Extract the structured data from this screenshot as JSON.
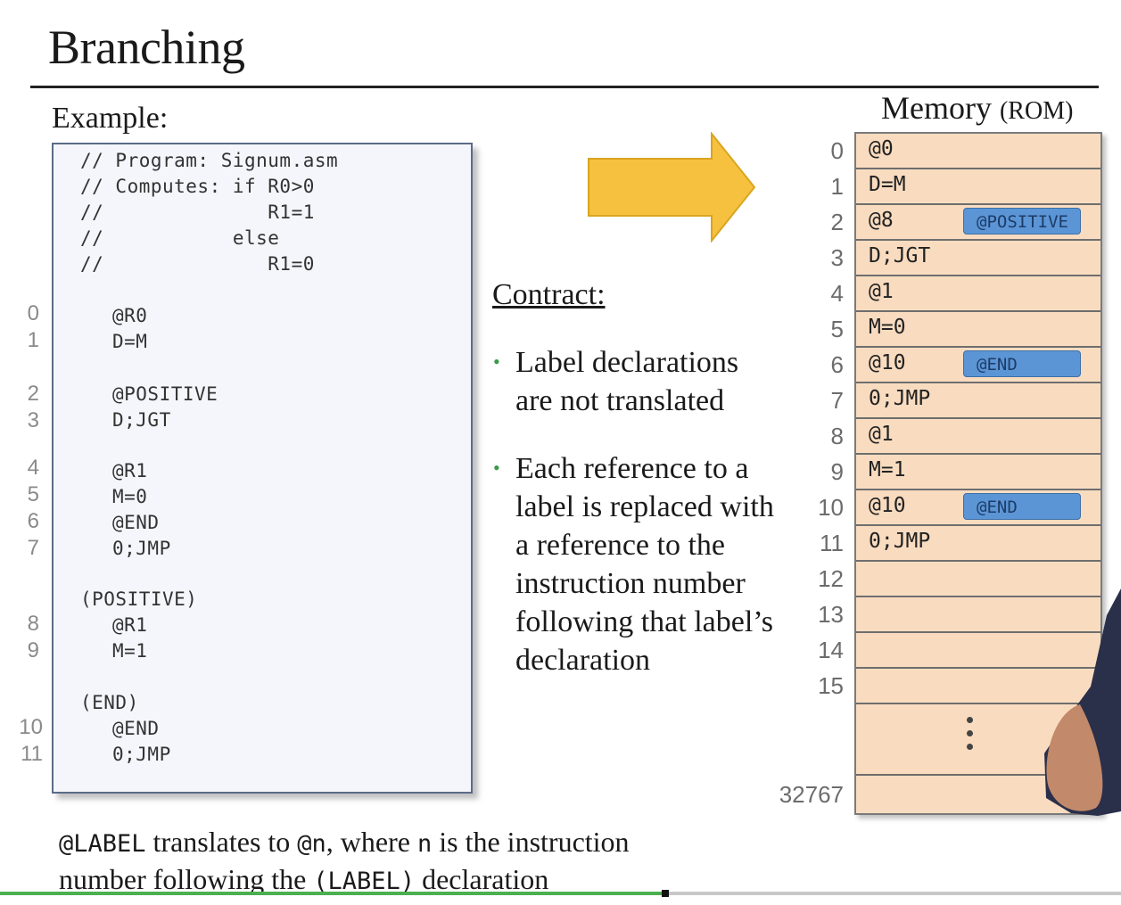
{
  "slide": {
    "title": "Branching",
    "example_label": "Example:"
  },
  "code": {
    "lines": [
      "// Program: Signum.asm",
      "// Computes: if R0>0",
      "//              R1=1",
      "//           else",
      "//              R1=0",
      "@R0",
      "D=M",
      "@POSITIVE",
      "D;JGT",
      "@R1",
      "M=0",
      "@END",
      "0;JMP",
      "(POSITIVE)",
      "@R1",
      "M=1",
      "(END)",
      "@END",
      "0;JMP"
    ],
    "line_numbers": [
      "0",
      "1",
      "2",
      "3",
      "4",
      "5",
      "6",
      "7",
      "8",
      "9",
      "10",
      "11"
    ]
  },
  "contract": {
    "title": "Contract:",
    "bullet1": [
      "Label declarations",
      "are not translated"
    ],
    "bullet2": [
      "Each reference to a",
      "label is replaced with",
      "a reference to the",
      "instruction number",
      "following  that label’s",
      "declaration"
    ]
  },
  "memory": {
    "title_main": "Memory ",
    "title_sub": "(ROM)",
    "rows": [
      {
        "index": "0",
        "value": "@0",
        "badge": ""
      },
      {
        "index": "1",
        "value": "D=M",
        "badge": ""
      },
      {
        "index": "2",
        "value": "@8",
        "badge": "@POSITIVE"
      },
      {
        "index": "3",
        "value": "D;JGT",
        "badge": ""
      },
      {
        "index": "4",
        "value": "@1",
        "badge": ""
      },
      {
        "index": "5",
        "value": "M=0",
        "badge": ""
      },
      {
        "index": "6",
        "value": "@10",
        "badge": "@END"
      },
      {
        "index": "7",
        "value": "0;JMP",
        "badge": ""
      },
      {
        "index": "8",
        "value": "@1",
        "badge": ""
      },
      {
        "index": "9",
        "value": "M=1",
        "badge": ""
      },
      {
        "index": "10",
        "value": "@10",
        "badge": "@END"
      },
      {
        "index": "11",
        "value": "0;JMP",
        "badge": ""
      },
      {
        "index": "12",
        "value": "",
        "badge": ""
      },
      {
        "index": "13",
        "value": "",
        "badge": ""
      },
      {
        "index": "14",
        "value": "",
        "badge": ""
      },
      {
        "index": "15",
        "value": "",
        "badge": ""
      }
    ],
    "last_index": "32767"
  },
  "footer": {
    "l1_a": "@LABEL",
    "l1_b": " translates to  ",
    "l1_c": "@n",
    "l1_d": ", where ",
    "l1_e": "n",
    "l1_f": " is  the instruction",
    "l2_a": "number following  the ",
    "l2_b": "(LABEL)",
    "l2_c": " declaration"
  },
  "video": {
    "progress_fraction": 0.59
  },
  "colors": {
    "arrow_fill": "#f6c13f",
    "memory_fill": "#f9dcc0",
    "badge_fill": "#5b95d6",
    "bullet_color": "#3a9a4a",
    "progress_color": "#4caf50"
  }
}
